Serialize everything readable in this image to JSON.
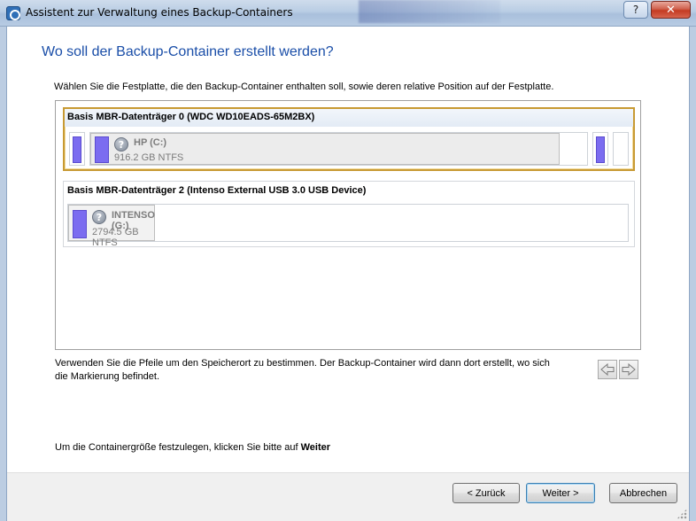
{
  "window": {
    "title": "Assistent zur Verwaltung eines Backup-Containers",
    "help_label": "?",
    "close_label": "✕"
  },
  "heading": "Wo soll der Backup-Container erstellt werden?",
  "instruction": "Wählen Sie die Festplatte, die den Backup-Container enthalten soll, sowie deren relative Position auf der Festplatte.",
  "disks": [
    {
      "title": "Basis MBR-Datenträger 0 (WDC WD10EADS-65M2BX)",
      "selected": true,
      "partition": {
        "name": "HP (C:)",
        "size": "916.2 GB NTFS"
      }
    },
    {
      "title": "Basis MBR-Datenträger 2 (Intenso External USB 3.0 USB Device)",
      "selected": false,
      "partition": {
        "name": "INTENSO (G:)",
        "size": "2794.5 GB NTFS"
      }
    }
  ],
  "hint": "Verwenden Sie die Pfeile um den Speicherort zu bestimmen. Der Backup-Container wird dann dort erstellt, wo sich die Markierung befindet.",
  "footer": {
    "prefix": "Um die Containergröße festzulegen, klicken Sie bitte auf ",
    "emphasis": "Weiter"
  },
  "buttons": {
    "back": "< Zurück",
    "next": "Weiter >",
    "cancel": "Abbrechen"
  },
  "colors": {
    "heading": "#1a4ea8",
    "partition_bar": "#7b6cf0",
    "selection_border": "#c89a33"
  }
}
